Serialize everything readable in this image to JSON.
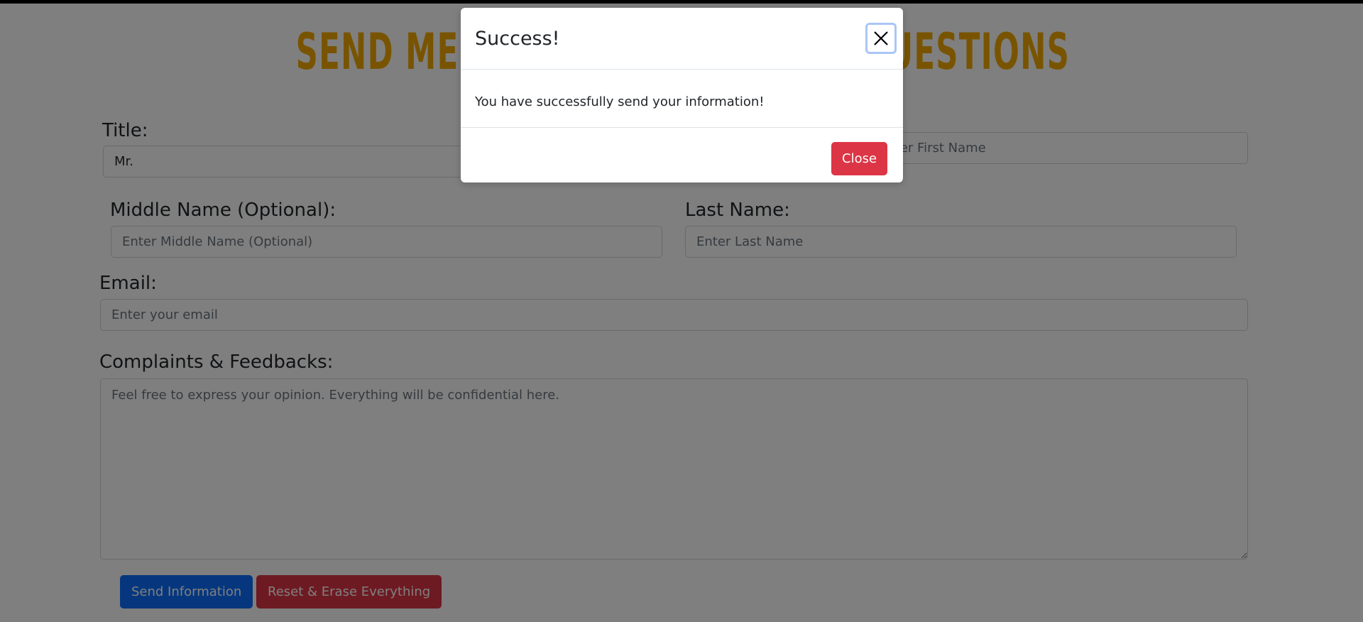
{
  "page": {
    "heading": "SEND ME A MESSAGE FOR ANY QUESTIONS"
  },
  "form": {
    "title_label": "Title:",
    "title_value": "Mr.",
    "first_name_placeholder": "Enter First Name",
    "middle_name_label": "Middle Name (Optional):",
    "middle_name_placeholder": "Enter Middle Name (Optional)",
    "last_name_label": "Last Name:",
    "last_name_placeholder": "Enter Last Name",
    "email_label": "Email:",
    "email_placeholder": "Enter your email",
    "feedback_label": "Complaints & Feedbacks:",
    "feedback_placeholder": "Feel free to express your opinion. Everything will be confidential here.",
    "send_button": "Send Information",
    "reset_button": "Reset & Erase Everything"
  },
  "modal": {
    "title": "Success!",
    "message": "You have successfully send your information!",
    "close_button": "Close",
    "close_icon": "close-icon"
  },
  "colors": {
    "heading": "#f2a900",
    "primary": "#0d6efd",
    "danger": "#dc3545",
    "backdrop": "rgba(0,0,0,0.5)"
  }
}
